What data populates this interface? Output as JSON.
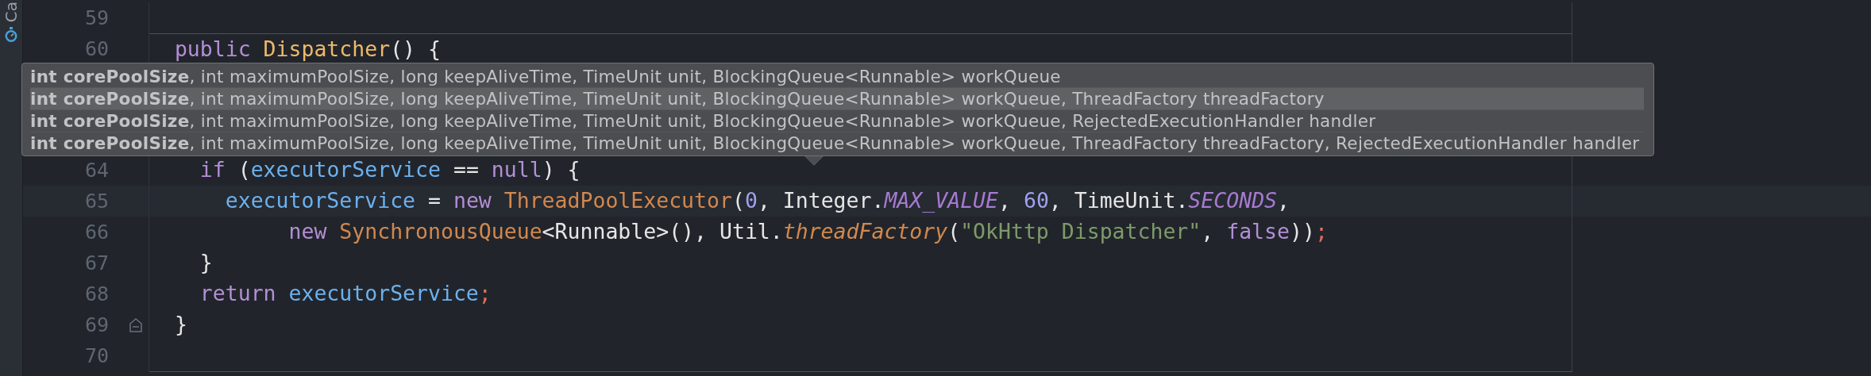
{
  "side_strip": {
    "label": "Ca"
  },
  "editor": {
    "lines": [
      {
        "number": "59",
        "current": false,
        "fold_end": false,
        "separator_above": false
      },
      {
        "number": "60",
        "current": false,
        "fold_end": false,
        "separator_above": true,
        "tokens": [
          {
            "kind": "keyword",
            "text": "  public "
          },
          {
            "kind": "declaration",
            "text": "Dispatcher"
          },
          {
            "kind": "plain",
            "text": "() {"
          }
        ]
      },
      {
        "number": "64",
        "current": false,
        "fold_end": false,
        "separator_above": false,
        "tokens": [
          {
            "kind": "keyword",
            "text": "    if"
          },
          {
            "kind": "plain",
            "text": " ("
          },
          {
            "kind": "field",
            "text": "executorService"
          },
          {
            "kind": "plain",
            "text": " == "
          },
          {
            "kind": "keyword",
            "text": "null"
          },
          {
            "kind": "plain",
            "text": ") {"
          }
        ]
      },
      {
        "number": "65",
        "current": true,
        "fold_end": false,
        "separator_above": false,
        "tokens": [
          {
            "kind": "field",
            "text": "      executorService"
          },
          {
            "kind": "plain",
            "text": " = "
          },
          {
            "kind": "keyword",
            "text": "new "
          },
          {
            "kind": "type",
            "text": "ThreadPoolExecutor"
          },
          {
            "kind": "plain",
            "text": "("
          },
          {
            "kind": "number",
            "text": "0"
          },
          {
            "kind": "plain",
            "text": ", Integer."
          },
          {
            "kind": "constant",
            "text": "MAX_VALUE"
          },
          {
            "kind": "plain",
            "text": ", "
          },
          {
            "kind": "number",
            "text": "60"
          },
          {
            "kind": "plain",
            "text": ", TimeUnit."
          },
          {
            "kind": "constant",
            "text": "SECONDS"
          },
          {
            "kind": "plain",
            "text": ","
          }
        ]
      },
      {
        "number": "66",
        "current": false,
        "fold_end": false,
        "separator_above": false,
        "tokens": [
          {
            "kind": "keyword",
            "text": "           new "
          },
          {
            "kind": "type",
            "text": "SynchronousQueue"
          },
          {
            "kind": "plain",
            "text": "<Runnable>(), Util."
          },
          {
            "kind": "method",
            "text": "threadFactory"
          },
          {
            "kind": "plain",
            "text": "("
          },
          {
            "kind": "string",
            "text": "\"OkHttp Dispatcher\""
          },
          {
            "kind": "plain",
            "text": ", "
          },
          {
            "kind": "keyword",
            "text": "false"
          },
          {
            "kind": "plain",
            "text": "))"
          },
          {
            "kind": "semicolon",
            "text": ";"
          }
        ]
      },
      {
        "number": "67",
        "current": false,
        "fold_end": false,
        "separator_above": false,
        "tokens": [
          {
            "kind": "plain",
            "text": "    }"
          }
        ]
      },
      {
        "number": "68",
        "current": false,
        "fold_end": false,
        "separator_above": false,
        "tokens": [
          {
            "kind": "keyword",
            "text": "    return "
          },
          {
            "kind": "field",
            "text": "executorService"
          },
          {
            "kind": "semicolon",
            "text": ";"
          }
        ]
      },
      {
        "number": "69",
        "current": false,
        "fold_end": true,
        "separator_above": false,
        "tokens": [
          {
            "kind": "plain",
            "text": "  }"
          }
        ]
      },
      {
        "number": "70",
        "current": false,
        "fold_end": false,
        "separator_above": false
      }
    ]
  },
  "parameter_info": {
    "rows": [
      {
        "text": "**int corePoolSize**, int maximumPoolSize, long keepAliveTime, TimeUnit unit, BlockingQueue<Runnable> workQueue",
        "selected": false
      },
      {
        "text": "**int corePoolSize**, int maximumPoolSize, long keepAliveTime, TimeUnit unit, BlockingQueue<Runnable> workQueue, ThreadFactory threadFactory",
        "selected": true
      },
      {
        "text": "**int corePoolSize**, int maximumPoolSize, long keepAliveTime, TimeUnit unit, BlockingQueue<Runnable> workQueue, RejectedExecutionHandler handler",
        "selected": false
      },
      {
        "text": "**int corePoolSize**, int maximumPoolSize, long keepAliveTime, TimeUnit unit, BlockingQueue<Runnable> workQueue, ThreadFactory threadFactory, RejectedExecutionHandler handler",
        "selected": false
      }
    ]
  }
}
